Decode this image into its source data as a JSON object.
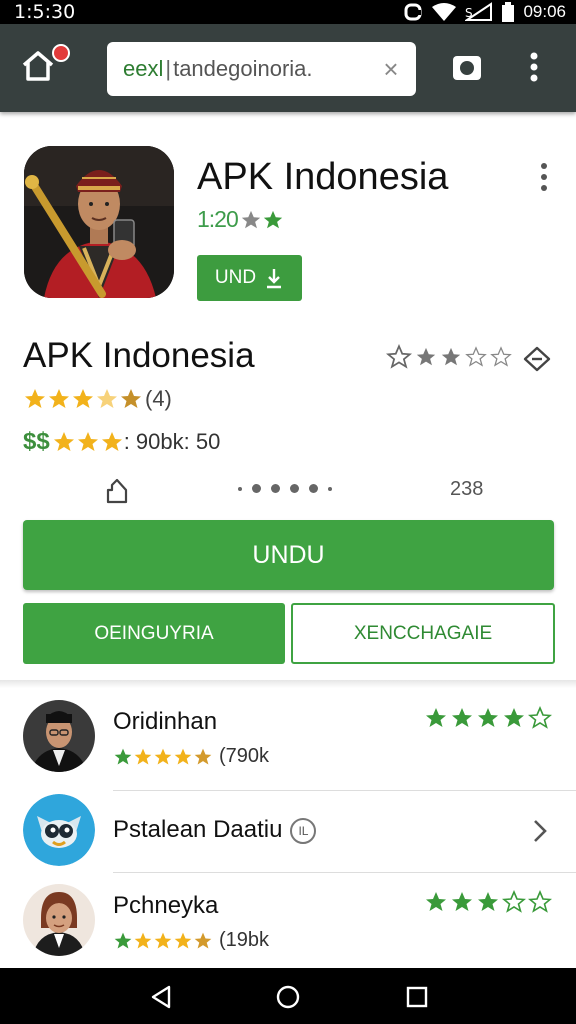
{
  "status_bar": {
    "time": "1:5:30",
    "clock_right": "09:06",
    "icons": [
      "sync-icon",
      "wifi-icon",
      "signal-icon",
      "battery-icon"
    ]
  },
  "browser": {
    "url_scheme": "eexl",
    "url_host": "tandegoinoria.",
    "icons": [
      "home-icon",
      "clear-icon",
      "camera-icon",
      "more-vert-icon"
    ]
  },
  "app": {
    "title": "APK Indonesia",
    "rating_value": "1:20",
    "stars_filled": 2,
    "install_label": "UND"
  },
  "details": {
    "title": "APK Indonesia",
    "rating_count": "(4)",
    "downloads_prefix": "$$",
    "downloads_text": ": 90bk: 50",
    "meta_number": "238"
  },
  "actions": {
    "primary": "UNDU",
    "secondary_left": "OEINGUYRIA",
    "secondary_right": "XENCCHAGAIE"
  },
  "list": [
    {
      "name": "Oridinhan",
      "sub": "(790k",
      "right_stars": 4
    },
    {
      "name": "Pstalean Daatiu",
      "badge": "IL"
    },
    {
      "name": "Pchneyka",
      "sub": "(19bk",
      "right_stars": 3
    }
  ],
  "colors": {
    "green": "#3fa342",
    "toolbar": "#37403f",
    "star_gold": "#f2b21b"
  }
}
